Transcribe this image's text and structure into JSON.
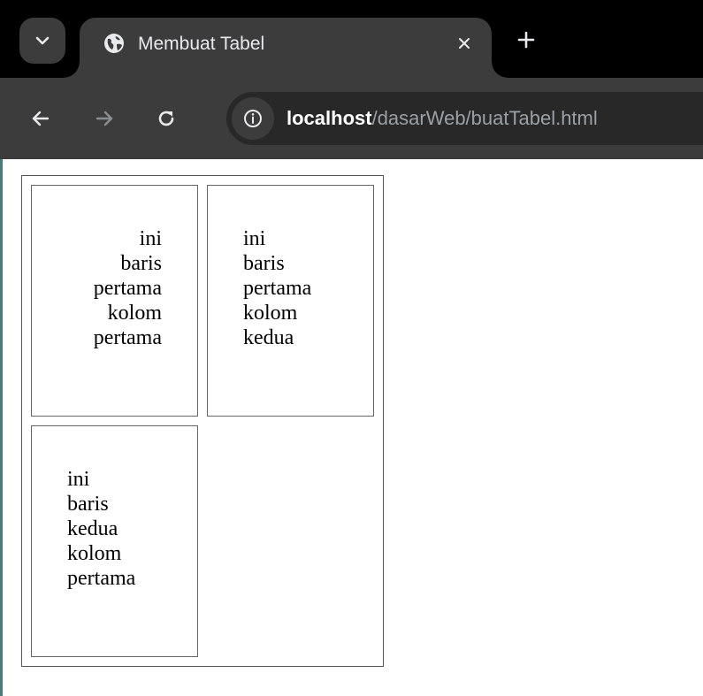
{
  "browser": {
    "tab": {
      "title": "Membuat Tabel",
      "favicon": "globe-icon",
      "close_icon": "close-icon"
    },
    "new_tab_icon": "plus-icon",
    "tab_search_icon": "chevron-down-icon",
    "toolbar": {
      "back_icon": "arrow-left-icon",
      "forward_icon": "arrow-right-icon",
      "reload_icon": "reload-icon",
      "site_info_icon": "info-icon"
    },
    "url": {
      "host": "localhost",
      "path": "/dasarWeb/buatTabel.html"
    },
    "colors": {
      "tabstrip": "#000000",
      "toolbar": "#3c3c3c",
      "omnibox": "#282828",
      "url_host": "#ffffff",
      "url_path": "#9aa0a6"
    }
  },
  "page": {
    "table": {
      "rows": [
        {
          "cells": [
            {
              "text": "ini baris pertama kolom pertama",
              "align": "right"
            },
            {
              "text": "ini baris pertama kolom kedua",
              "align": "left"
            }
          ]
        },
        {
          "cells": [
            {
              "text": "ini baris kedua kolom pertama",
              "align": "left"
            }
          ]
        }
      ]
    }
  }
}
